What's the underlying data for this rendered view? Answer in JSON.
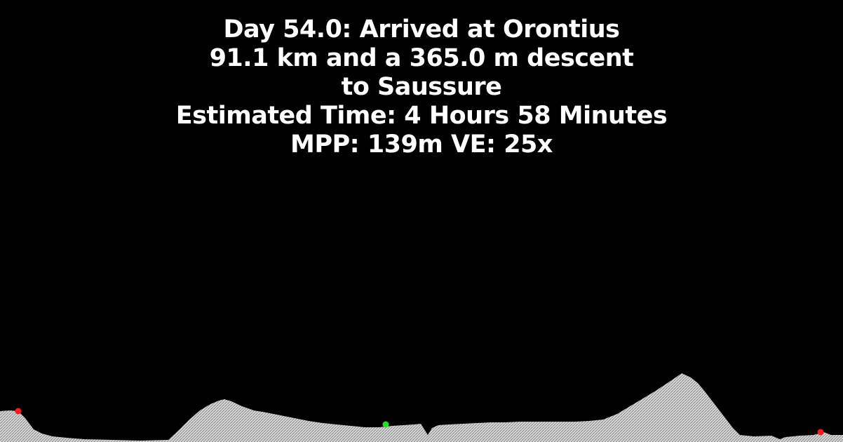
{
  "header": {
    "day_line": "Day 54.0: Arrived at Orontius",
    "distance_line": "91.1 km and a 365.0 m descent",
    "destination_line": "to Saussure",
    "time_line": "Estimated Time: 4 Hours 58 Minutes",
    "scale_line": "MPP: 139m VE: 25x"
  },
  "colors": {
    "background": "#000000",
    "terrain_fill": "#d8d8d8",
    "terrain_hatch": "#8a8a8a",
    "start_marker": "#ff1a1a",
    "current_marker": "#22e022",
    "end_marker": "#ff1a1a"
  }
}
